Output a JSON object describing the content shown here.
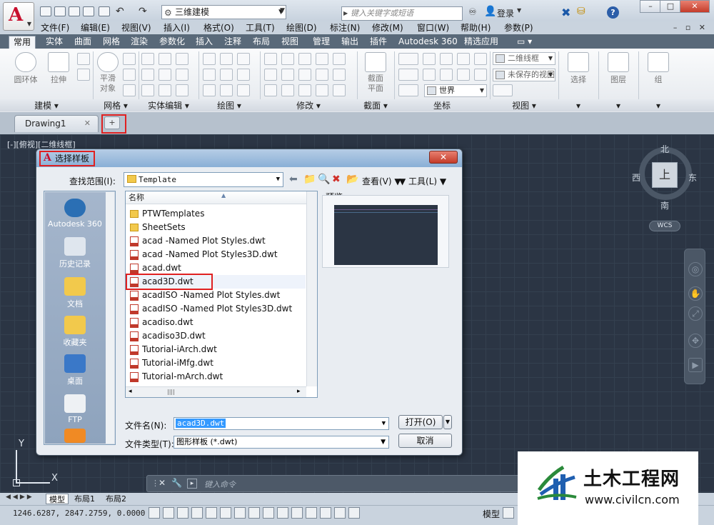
{
  "titlebar": {
    "workspace": "三维建模",
    "search_placeholder": "键入关键字或短语",
    "login": "登录",
    "window_buttons": [
      "–",
      "□",
      "✕"
    ]
  },
  "menu": [
    "文件(F)",
    "编辑(E)",
    "视图(V)",
    "插入(I)",
    "格式(O)",
    "工具(T)",
    "绘图(D)",
    "标注(N)",
    "修改(M)",
    "窗口(W)",
    "帮助(H)",
    "参数(P)"
  ],
  "ribbon_tabs": [
    "常用",
    "实体",
    "曲面",
    "网格",
    "渲染",
    "参数化",
    "插入",
    "注释",
    "布局",
    "视图",
    "管理",
    "输出",
    "插件",
    "Autodesk 360",
    "精选应用"
  ],
  "ribbon": {
    "big_tools": [
      "圆环体",
      "拉伸",
      "平滑对象"
    ],
    "panels": [
      "建模",
      "网格",
      "实体编辑",
      "绘图",
      "修改",
      "截面",
      "坐标",
      "视图"
    ],
    "visual_style": "二维线框",
    "view_state": "未保存的视图",
    "ucs": "世界",
    "section_tool": "截面平面",
    "right_tools": [
      "选择",
      "图层",
      "组"
    ]
  },
  "doc_tabs": {
    "drawing": "Drawing1"
  },
  "viewport_label": "[-][俯视][二维线框]",
  "viewcube": {
    "top": "上",
    "north": "北",
    "south": "南",
    "east": "东",
    "west": "西",
    "wcs": "WCS"
  },
  "ucs": {
    "x": "X",
    "y": "Y"
  },
  "command_placeholder": "键入命令",
  "layout_tabs": [
    "模型",
    "布局1",
    "布局2"
  ],
  "status": {
    "coords": "1246.6287, 2847.2759, 0.0000",
    "model": "模型"
  },
  "dialog": {
    "title": "选择样板",
    "close": "✕",
    "look_in_label": "查找范围(I):",
    "look_in_value": "Template",
    "views_label": "查看(V)",
    "tools_label": "工具(L)",
    "places": [
      "Autodesk 360",
      "历史记录",
      "文档",
      "收藏夹",
      "桌面",
      "FTP"
    ],
    "column_name": "名称",
    "files": [
      {
        "name": "PTWTemplates",
        "type": "folder"
      },
      {
        "name": "SheetSets",
        "type": "folder"
      },
      {
        "name": "acad -Named Plot Styles.dwt",
        "type": "dwt"
      },
      {
        "name": "acad -Named Plot Styles3D.dwt",
        "type": "dwt"
      },
      {
        "name": "acad.dwt",
        "type": "dwt"
      },
      {
        "name": "acad3D.dwt",
        "type": "dwt"
      },
      {
        "name": "acadISO -Named Plot Styles.dwt",
        "type": "dwt"
      },
      {
        "name": "acadISO -Named Plot Styles3D.dwt",
        "type": "dwt"
      },
      {
        "name": "acadiso.dwt",
        "type": "dwt"
      },
      {
        "name": "acadiso3D.dwt",
        "type": "dwt"
      },
      {
        "name": "Tutorial-iArch.dwt",
        "type": "dwt"
      },
      {
        "name": "Tutorial-iMfg.dwt",
        "type": "dwt"
      },
      {
        "name": "Tutorial-mArch.dwt",
        "type": "dwt"
      }
    ],
    "selected_file": "acad3D.dwt",
    "preview_label": "预览",
    "filename_label": "文件名(N):",
    "filename_value": "acad3D.dwt",
    "filetype_label": "文件类型(T):",
    "filetype_value": "图形样板 (*.dwt)",
    "open_button": "打开(O)",
    "cancel_button": "取消"
  },
  "watermark": {
    "title": "土木工程网",
    "url": "www.civilcn.com"
  },
  "colors": {
    "highlight_red": "#e02020",
    "canvas": "#2b3544",
    "selection": "#3399ff",
    "autocad_red": "#c8102e"
  }
}
